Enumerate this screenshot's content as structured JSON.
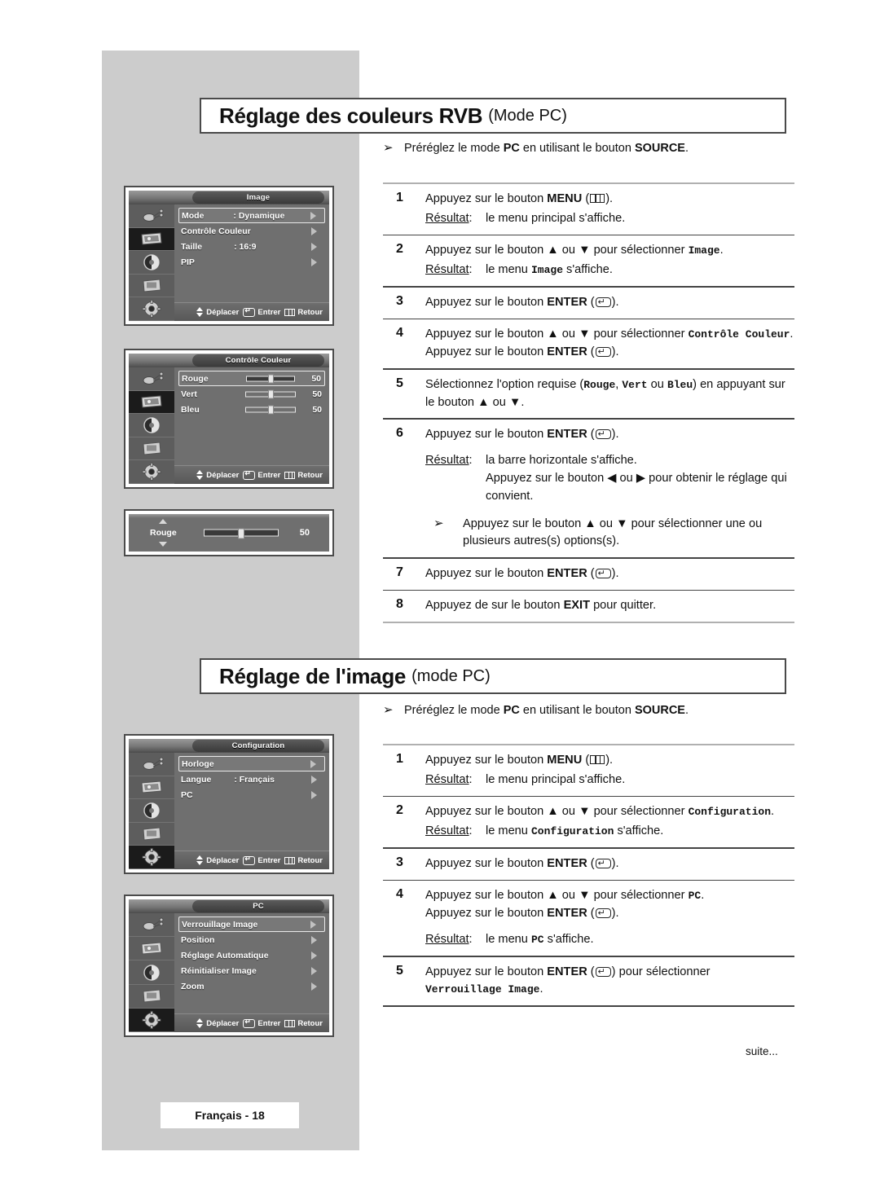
{
  "page": {
    "footer_label": "Français - 18",
    "continuation": "suite..."
  },
  "sections": [
    {
      "id": "rvb",
      "title_main": "Réglage des couleurs RVB",
      "title_sub": "(Mode PC)",
      "preset_note": {
        "arrow": "➢",
        "parts": [
          "Préréglez le mode ",
          "PC",
          " en utilisant le bouton ",
          "SOURCE",
          "."
        ]
      },
      "steps": [
        {
          "num": "1",
          "lines": [
            {
              "pre": "Appuyez sur le bouton ",
              "bold": "MENU",
              "icon": "menu-icon",
              "post": "."
            }
          ],
          "result": {
            "label": "Résultat:",
            "value": "le menu principal s'affiche."
          }
        },
        {
          "num": "2",
          "lines": [
            {
              "pre": "Appuyez sur le bouton ▲ ou ▼ pour sélectionner ",
              "mono": "Image",
              "post": "."
            }
          ],
          "result": {
            "label": "Résultat:",
            "value_pre": "le menu ",
            "value_mono": "Image",
            "value_post": " s'affiche."
          }
        },
        {
          "num": "3",
          "lines": [
            {
              "pre": "Appuyez sur le bouton ",
              "bold": "ENTER",
              "icon": "enter-icon",
              "post": "."
            }
          ]
        },
        {
          "num": "4",
          "lines": [
            {
              "pre": "Appuyez sur le bouton ▲ ou ▼ pour sélectionner ",
              "mono": "Contrôle Couleur",
              "post": "."
            },
            {
              "pre": "Appuyez sur le bouton ",
              "bold": "ENTER",
              "icon": "enter-icon",
              "post": "."
            }
          ]
        },
        {
          "num": "5",
          "lines": [
            {
              "text_segments": [
                "Sélectionnez l'option requise (",
                "Rouge",
                ", ",
                "Vert",
                " ou ",
                "Bleu",
                ") en appuyant sur le bouton ▲ ou ▼."
              ]
            }
          ]
        },
        {
          "num": "6",
          "lines": [
            {
              "pre": "Appuyez sur le bouton ",
              "bold": "ENTER",
              "icon": "enter-icon",
              "post": "."
            }
          ],
          "result": {
            "label": "Résultat:",
            "value": "la barre horizontale s'affiche.",
            "value2": "Appuyez sur le bouton ◀ ou ▶ pour obtenir le réglage qui convient."
          },
          "sub_note": {
            "arrow": "➢",
            "text": "Appuyez sur le bouton ▲ ou ▼ pour sélectionner une ou plusieurs autres(s) options(s)."
          }
        },
        {
          "num": "7",
          "lines": [
            {
              "pre": "Appuyez sur le bouton ",
              "bold": "ENTER",
              "icon": "enter-icon",
              "post": "."
            }
          ]
        },
        {
          "num": "8",
          "lines": [
            {
              "pre": "Appuyez de sur le bouton ",
              "bold": "EXIT",
              "post": " pour quitter."
            }
          ]
        }
      ]
    },
    {
      "id": "image",
      "title_main": "Réglage de l'image",
      "title_sub": "(mode PC)",
      "preset_note": {
        "arrow": "➢",
        "parts": [
          "Préréglez le mode ",
          "PC",
          " en utilisant le bouton ",
          "SOURCE",
          "."
        ]
      },
      "steps": [
        {
          "num": "1",
          "lines": [
            {
              "pre": "Appuyez sur le bouton ",
              "bold": "MENU",
              "icon": "menu-icon",
              "post": "."
            }
          ],
          "result": {
            "label": "Résultat:",
            "value": "le menu principal s'affiche."
          }
        },
        {
          "num": "2",
          "lines": [
            {
              "pre": "Appuyez sur le bouton ▲ ou ▼ pour sélectionner ",
              "mono": "Configuration",
              "post": "."
            }
          ],
          "result": {
            "label": "Résultat:",
            "value_pre": "le menu ",
            "value_mono": "Configuration",
            "value_post": " s'affiche."
          }
        },
        {
          "num": "3",
          "lines": [
            {
              "pre": "Appuyez sur le bouton ",
              "bold": "ENTER",
              "icon": "enter-icon",
              "post": "."
            }
          ]
        },
        {
          "num": "4",
          "lines": [
            {
              "pre": "Appuyez sur le bouton ▲ ou ▼ pour sélectionner ",
              "mono": "PC",
              "post": "."
            },
            {
              "pre": "Appuyez sur le bouton ",
              "bold": "ENTER",
              "icon": "enter-icon",
              "post": "."
            }
          ],
          "result": {
            "label": "Résultat:",
            "value_pre": "le menu ",
            "value_mono": "PC",
            "value_post": " s'affiche."
          }
        },
        {
          "num": "5",
          "lines": [
            {
              "pre": "Appuyez sur le bouton ",
              "bold": "ENTER",
              "icon": "enter-icon",
              "post": ") pour sélectionner"
            },
            {
              "mono": "Verrouillage Image",
              "post": "."
            }
          ]
        }
      ]
    }
  ],
  "osd_menus": [
    {
      "id": "image-menu",
      "title": "Image",
      "active_sidebar_index": 1,
      "rows": [
        {
          "label": "Mode",
          "value": ": Dynamique",
          "caret": true,
          "selected": true
        },
        {
          "label": "Contrôle Couleur",
          "value": "",
          "caret": true,
          "selected": false
        },
        {
          "label": "Taille",
          "value": ": 16:9",
          "caret": true,
          "selected": false
        },
        {
          "label": "PIP",
          "value": "",
          "caret": true,
          "selected": false
        }
      ],
      "footer": {
        "move": "Déplacer",
        "enter": "Entrer",
        "back": "Retour"
      }
    },
    {
      "id": "color-control-menu",
      "title": "Contrôle Couleur",
      "active_sidebar_index": 1,
      "slider_rows": [
        {
          "label": "Rouge",
          "value": "50",
          "percent": 50,
          "selected": true
        },
        {
          "label": "Vert",
          "value": "50",
          "percent": 50,
          "selected": false
        },
        {
          "label": "Bleu",
          "value": "50",
          "percent": 50,
          "selected": false
        }
      ],
      "footer": {
        "move": "Déplacer",
        "enter": "Entrer",
        "back": "Retour"
      }
    },
    {
      "id": "configuration-menu",
      "title": "Configuration",
      "active_sidebar_index": 4,
      "rows": [
        {
          "label": "Horloge",
          "value": "",
          "caret": true,
          "selected": true
        },
        {
          "label": "Langue",
          "value": ": Français",
          "caret": true,
          "selected": false
        },
        {
          "label": "PC",
          "value": "",
          "caret": true,
          "selected": false
        }
      ],
      "footer": {
        "move": "Déplacer",
        "enter": "Entrer",
        "back": "Retour"
      }
    },
    {
      "id": "pc-menu",
      "title": "PC",
      "active_sidebar_index": 4,
      "rows": [
        {
          "label": "Verrouillage Image",
          "value": "",
          "caret": true,
          "selected": true
        },
        {
          "label": "Position",
          "value": "",
          "caret": true,
          "selected": false
        },
        {
          "label": "Réglage Automatique",
          "value": "",
          "caret": true,
          "selected": false
        },
        {
          "label": "Réinitialiser Image",
          "value": "",
          "caret": true,
          "selected": false
        },
        {
          "label": "Zoom",
          "value": "",
          "caret": true,
          "selected": false
        }
      ],
      "footer": {
        "move": "Déplacer",
        "enter": "Entrer",
        "back": "Retour"
      }
    }
  ],
  "bar_widget": {
    "label": "Rouge",
    "value": "50",
    "percent": 50
  },
  "sidebar_icons": [
    "antenna-icon",
    "picture-icon",
    "sound-icon",
    "screen-icon",
    "setup-gear-icon"
  ]
}
